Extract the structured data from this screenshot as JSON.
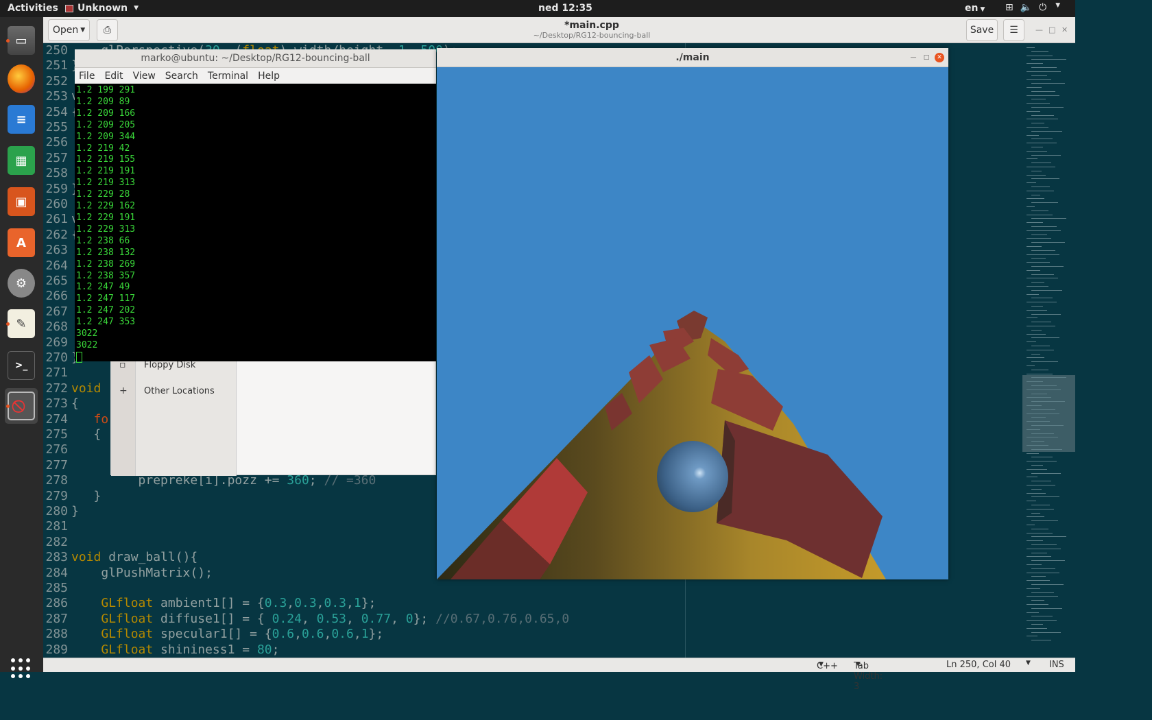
{
  "topbar": {
    "activities": "Activities",
    "app_name": "Unknown",
    "clock": "ned 12:35",
    "language": "en"
  },
  "dock": {
    "items": [
      "files-icon",
      "firefox-icon",
      "writer-icon",
      "calc-icon",
      "impress-icon",
      "software-icon",
      "settings-icon",
      "gedit-icon",
      "terminal-icon",
      "unknown-app-icon"
    ]
  },
  "gedit": {
    "open_label": "Open",
    "save_label": "Save",
    "title": "*main.cpp",
    "subtitle": "~/Desktop/RG12-bouncing-ball",
    "lines": [
      {
        "n": "250",
        "html": "    glPerspective(30, (float) width/height, 1, 500);"
      },
      {
        "n": "251",
        "html": "}"
      },
      {
        "n": "252",
        "html": ""
      },
      {
        "n": "253",
        "html": "v"
      },
      {
        "n": "254",
        "html": "{"
      },
      {
        "n": "255",
        "html": ""
      },
      {
        "n": "256",
        "html": ""
      },
      {
        "n": "257",
        "html": ""
      },
      {
        "n": "258",
        "html": ""
      },
      {
        "n": "259",
        "html": "}"
      },
      {
        "n": "260",
        "html": ""
      },
      {
        "n": "261",
        "html": "v"
      },
      {
        "n": "262",
        "html": "{"
      },
      {
        "n": "263",
        "html": ""
      },
      {
        "n": "264",
        "html": ""
      },
      {
        "n": "265",
        "html": ""
      },
      {
        "n": "266",
        "html": ""
      },
      {
        "n": "267",
        "html": ""
      },
      {
        "n": "268",
        "html": ""
      },
      {
        "n": "269",
        "html": ""
      },
      {
        "n": "270",
        "html": "}"
      },
      {
        "n": "271",
        "html": ""
      },
      {
        "n": "272",
        "html": "void"
      },
      {
        "n": "273",
        "html": "{"
      },
      {
        "n": "274",
        "html": "   fo"
      },
      {
        "n": "275",
        "html": "   {"
      },
      {
        "n": "276",
        "html": ""
      },
      {
        "n": "277",
        "html": ""
      },
      {
        "n": "278",
        "html": "         prepreke[i].pozz += 360; // =360"
      },
      {
        "n": "279",
        "html": "   }"
      },
      {
        "n": "280",
        "html": "}"
      },
      {
        "n": "281",
        "html": ""
      },
      {
        "n": "282",
        "html": ""
      },
      {
        "n": "283",
        "html": "void draw_ball(){"
      },
      {
        "n": "284",
        "html": "    glPushMatrix();"
      },
      {
        "n": "285",
        "html": ""
      },
      {
        "n": "286",
        "html": "    GLfloat ambient1[] = {0.3,0.3,0.3,1};"
      },
      {
        "n": "287",
        "html": "    GLfloat diffuse1[] = { 0.24, 0.53, 0.77, 0}; //0.67,0.76,0.65,0"
      },
      {
        "n": "288",
        "html": "    GLfloat specular1[] = {0.6,0.6,0.6,1};"
      },
      {
        "n": "289",
        "html": "    GLfloat shininess1 = 80;"
      }
    ],
    "status": {
      "language": "C++",
      "tab_width": "Tab Width: 3",
      "position": "Ln 250, Col 40",
      "mode": "INS"
    }
  },
  "files": {
    "floppy": "Floppy Disk",
    "other_locations": "Other Locations"
  },
  "terminal": {
    "title": "marko@ubuntu: ~/Desktop/RG12-bouncing-ball",
    "menu": [
      "File",
      "Edit",
      "View",
      "Search",
      "Terminal",
      "Help"
    ],
    "output": [
      "1.2 199 291",
      "1.2 209 89",
      "1.2 209 166",
      "1.2 209 205",
      "1.2 209 344",
      "1.2 219 42",
      "1.2 219 155",
      "1.2 219 191",
      "1.2 219 313",
      "1.2 229 28",
      "1.2 229 162",
      "1.2 229 191",
      "1.2 229 313",
      "1.2 238 66",
      "1.2 238 132",
      "1.2 238 269",
      "1.2 238 357",
      "1.2 247 49",
      "1.2 247 117",
      "1.2 247 202",
      "1.2 247 353",
      "3022",
      "3022"
    ]
  },
  "glwindow": {
    "title": "./main"
  }
}
